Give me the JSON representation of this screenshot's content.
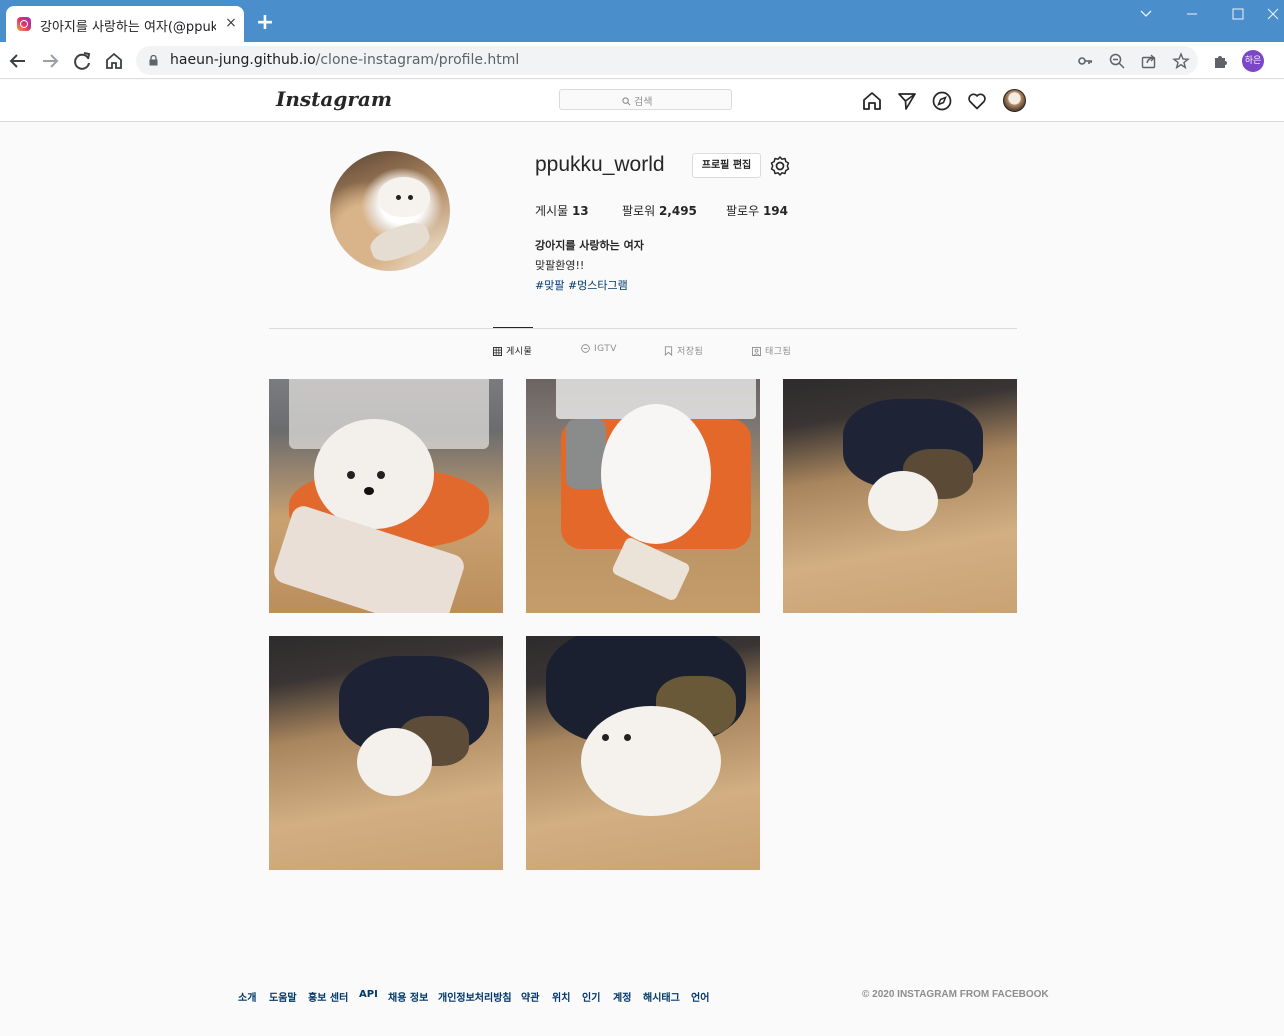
{
  "browser": {
    "tab_title": "강아지를 사랑하는 여자(@ppukku_world)",
    "tab_close": "×",
    "new_tab": "+",
    "url_host": "haeun-jung.github.io",
    "url_path": "/clone-instagram/profile.html",
    "profile_chip": "하은",
    "window_controls": [
      "minimize",
      "maximize",
      "close"
    ]
  },
  "header": {
    "logo": "Instagram",
    "search_placeholder": "검색",
    "nav_icons": [
      "home-icon",
      "direct-icon",
      "explore-icon",
      "activity-icon",
      "profile-avatar"
    ]
  },
  "profile": {
    "username": "ppukku_world",
    "edit_button": "프로필 편집",
    "stats": [
      {
        "label": "게시물",
        "value": "13"
      },
      {
        "label": "팔로워",
        "value": "2,495"
      },
      {
        "label": "팔로우",
        "value": "194"
      }
    ],
    "bio_name": "강아지를 사랑하는 여자",
    "bio_line": "맞팔환영!!",
    "bio_tags": "#맞팔 #멍스타그램"
  },
  "tabs": [
    {
      "label": "게시물",
      "icon": "grid-icon",
      "active": true
    },
    {
      "label": "IGTV",
      "icon": "igtv-icon",
      "active": false
    },
    {
      "label": "저장됨",
      "icon": "bookmark-icon",
      "active": false
    },
    {
      "label": "태그됨",
      "icon": "tagged-icon",
      "active": false
    }
  ],
  "posts_count_shown": 5,
  "footer": {
    "links": [
      "소개",
      "도움말",
      "홍보 센터",
      "API",
      "채용 정보",
      "개인정보처리방침",
      "약관",
      "위치",
      "인기",
      "계정",
      "해시태그",
      "언어"
    ],
    "copyright": "© 2020 INSTAGRAM FROM FACEBOOK"
  },
  "colors": {
    "tabbar": "#4a8ecb",
    "link": "#00376b",
    "muted": "#8e8e8e",
    "border": "#dbdbdb"
  }
}
